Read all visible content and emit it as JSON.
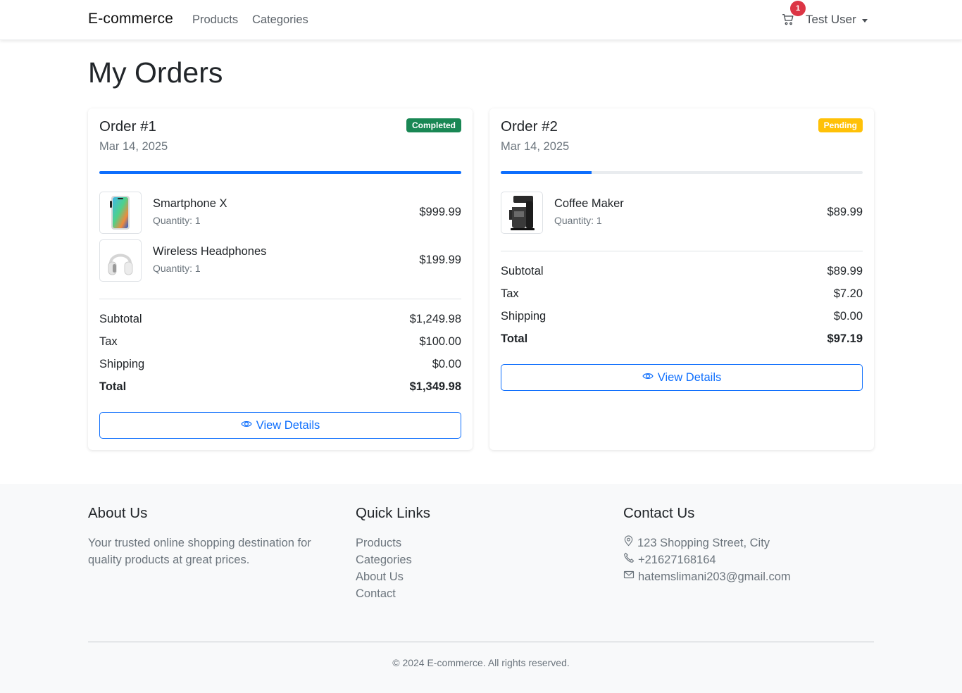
{
  "navbar": {
    "brand": "E-commerce",
    "links": [
      "Products",
      "Categories"
    ],
    "cart_count": "1",
    "user_name": "Test User"
  },
  "page": {
    "title": "My Orders"
  },
  "orders": [
    {
      "title": "Order #1",
      "date": "Mar 14, 2025",
      "status": "Completed",
      "progress_percent": 100,
      "items": [
        {
          "name": "Smartphone X",
          "quantity": "Quantity: 1",
          "price": "$999.99",
          "image": "smartphone-image"
        },
        {
          "name": "Wireless Headphones",
          "quantity": "Quantity: 1",
          "price": "$199.99",
          "image": "headphones-image"
        }
      ],
      "summary": {
        "subtotal_label": "Subtotal",
        "subtotal": "$1,249.98",
        "tax_label": "Tax",
        "tax": "$100.00",
        "shipping_label": "Shipping",
        "shipping": "$0.00",
        "total_label": "Total",
        "total": "$1,349.98"
      },
      "button_label": "View Details"
    },
    {
      "title": "Order #2",
      "date": "Mar 14, 2025",
      "status": "Pending",
      "progress_percent": 25,
      "items": [
        {
          "name": "Coffee Maker",
          "quantity": "Quantity: 1",
          "price": "$89.99",
          "image": "coffee-maker-image"
        }
      ],
      "summary": {
        "subtotal_label": "Subtotal",
        "subtotal": "$89.99",
        "tax_label": "Tax",
        "tax": "$7.20",
        "shipping_label": "Shipping",
        "shipping": "$0.00",
        "total_label": "Total",
        "total": "$97.19"
      },
      "button_label": "View Details"
    }
  ],
  "footer": {
    "about_title": "About Us",
    "about_text": "Your trusted online shopping destination for quality products at great prices.",
    "links_title": "Quick Links",
    "links": [
      "Products",
      "Categories",
      "About Us",
      "Contact"
    ],
    "contact_title": "Contact Us",
    "address": "123 Shopping Street, City",
    "phone": "+21627168164",
    "email": "hatemslimani203@gmail.com",
    "copyright": "© 2024 E-commerce. All rights reserved."
  },
  "colors": {
    "primary": "#0d6efd",
    "success": "#198754",
    "warning": "#ffc107",
    "danger": "#dc3545",
    "muted": "#6c757d"
  },
  "icons": [
    "cart-icon",
    "eye-icon",
    "map-pin-icon",
    "phone-icon",
    "envelope-icon"
  ]
}
